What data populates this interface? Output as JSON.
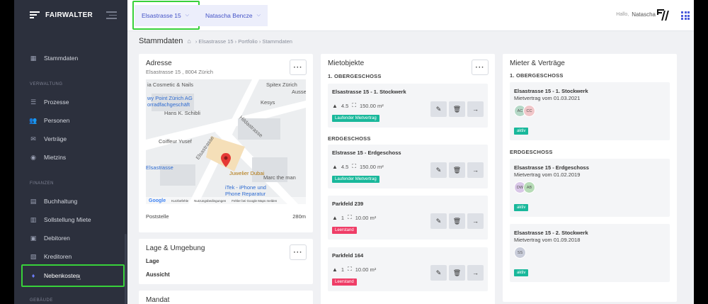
{
  "sidebar": {
    "brand": "FAIRWALTER",
    "items": [
      {
        "label": "Stammdaten",
        "icon": "buildings-icon"
      },
      {
        "label": "Prozesse",
        "icon": "list-icon"
      },
      {
        "label": "Personen",
        "icon": "people-icon"
      },
      {
        "label": "Verträge",
        "icon": "handshake-icon"
      },
      {
        "label": "Mietzins",
        "icon": "coin-icon"
      },
      {
        "label": "Buchhaltung",
        "icon": "ledger-icon"
      },
      {
        "label": "Sollstellung Miete",
        "icon": "invoice-icon"
      },
      {
        "label": "Debitoren",
        "icon": "debit-icon"
      },
      {
        "label": "Kreditoren",
        "icon": "credit-icon"
      },
      {
        "label": "Nebenkosten",
        "icon": "flame-icon"
      }
    ],
    "sections": {
      "verwaltung": "VERWALTUNG",
      "finanzen": "FINANZEN",
      "gebaeude": "GEBÄUDE"
    }
  },
  "topbar": {
    "property": "Elsastrasse 15",
    "owner": "Natascha Bencze",
    "hello": "Hallo,",
    "user": "Natascha"
  },
  "page": {
    "title": "Stammdaten",
    "breadcrumb": "› Elsastrasse 15 › Portfolio › Stammdaten"
  },
  "adresse": {
    "title": "Adresse",
    "address": "Elsastrasse 15 , 8004 Zürich",
    "poststelle_label": "Poststelle",
    "poststelle_value": "280m",
    "map_labels": {
      "a": "ia Cosmetic & Nails",
      "b": "Spitex Zürich",
      "c": "Ausse",
      "d": "wy Point Zürich AG",
      "e": "orradfachgeschäft",
      "f": "Hans K. Schibli",
      "g": "Kesys",
      "h": "Coiffeur Yusef",
      "i": "Hildastrasse",
      "j": "Elsastrasse",
      "k": "Juwelier Dubai",
      "l": "Elsastrasse",
      "m": "Marc the man",
      "n": "iTek - iPhone und",
      "o": "Phone Reparatur",
      "google": "Google",
      "shortcuts": "Kurzbefehle",
      "terms": "Nutzungsbedingungen",
      "report": "Fehler bei Google Maps melden"
    }
  },
  "lage": {
    "title": "Lage & Umgebung",
    "lage": "Lage",
    "aussicht": "Aussicht"
  },
  "mandat": {
    "title": "Mandat"
  },
  "mietobjekte": {
    "title": "Mietobjekte",
    "groups": {
      "og": "1. OBERGESCHOSS",
      "eg": "ERDGESCHOSS"
    },
    "units": [
      {
        "title": "Elsastrasse 15 - 1. Stockwerk",
        "rooms": "4.5",
        "area": "150.00 m²",
        "status": "Laufender Mietvertrag"
      },
      {
        "title": "Elstrasse 15 - Erdgeschoss",
        "rooms": "4.5",
        "area": "150.00 m²",
        "status": "Laufender Mietvertrag"
      },
      {
        "title": "Parkfeld 239",
        "rooms": "1",
        "area": "10.00 m²",
        "status": "Leerstand"
      },
      {
        "title": "Parkfeld 164",
        "rooms": "1",
        "area": "10.00 m²",
        "status": "Leerstand"
      }
    ]
  },
  "mieter": {
    "title": "Mieter & Verträge",
    "groups": {
      "og": "1. OBERGESCHOSS",
      "eg": "ERDGESCHOSS"
    },
    "contracts": [
      {
        "title": "Elsastrasse 15 - 1. Stockwerk",
        "sub": "Mietvertrag vom 01.03.2021",
        "avatars": [
          "AC",
          "CC"
        ],
        "status": "aktiv"
      },
      {
        "title": "Elsastrasse 15 - Erdgeschoss",
        "sub": "Mietvertrag vom 01.02.2019",
        "avatars": [
          "DW",
          "AB"
        ],
        "status": "aktiv"
      },
      {
        "title": "Elsastrasse 15 - 2. Stockwerk",
        "sub": "Mietvertrag vom 01.09.2018",
        "avatars": [
          "SS"
        ],
        "status": "aktiv"
      }
    ]
  },
  "colors": {
    "accent": "#4453c7",
    "highlight": "#38d13a",
    "active_badge": "#19b89b",
    "vacant_badge": "#ef3d67"
  }
}
